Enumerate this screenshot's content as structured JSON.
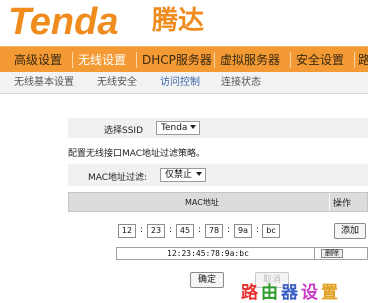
{
  "brand": {
    "logo": "Tenda",
    "logo_cn": "腾达"
  },
  "mainnav": {
    "items": [
      "高级设置",
      "无线设置",
      "DHCP服务器",
      "虚拟服务器",
      "安全设置",
      "路"
    ]
  },
  "subnav": {
    "items": [
      "无线基本设置",
      "无线安全",
      "访问控制",
      "连接状态"
    ]
  },
  "form": {
    "ssid_label": "选择SSID",
    "ssid_value": "Tenda",
    "description": "配置无线接口MAC地址过滤策略。",
    "filter_label": "MAC地址过滤:",
    "filter_value": "仅禁止",
    "table_col_mac": "MAC地址",
    "table_col_action": "操作",
    "mac_parts": [
      "12",
      "23",
      "45",
      "78",
      "9a",
      "bc"
    ],
    "add_label": "添加",
    "entry_mac": "12:23:45:78:9a:bc",
    "delete_label": "删除",
    "ok_label": "确定",
    "cancel_label": "取消"
  },
  "watermark": {
    "chars": [
      "路",
      "由",
      "器",
      "设",
      "置"
    ],
    "colors": [
      "#e83030",
      "#2a9a2a",
      "#3a5ec8",
      "#c83ac8",
      "#e0a020"
    ]
  },
  "colors": {
    "brand_orange": "#f08c1e",
    "nav_orange": "#f39a34",
    "active_link": "#3866a8"
  }
}
